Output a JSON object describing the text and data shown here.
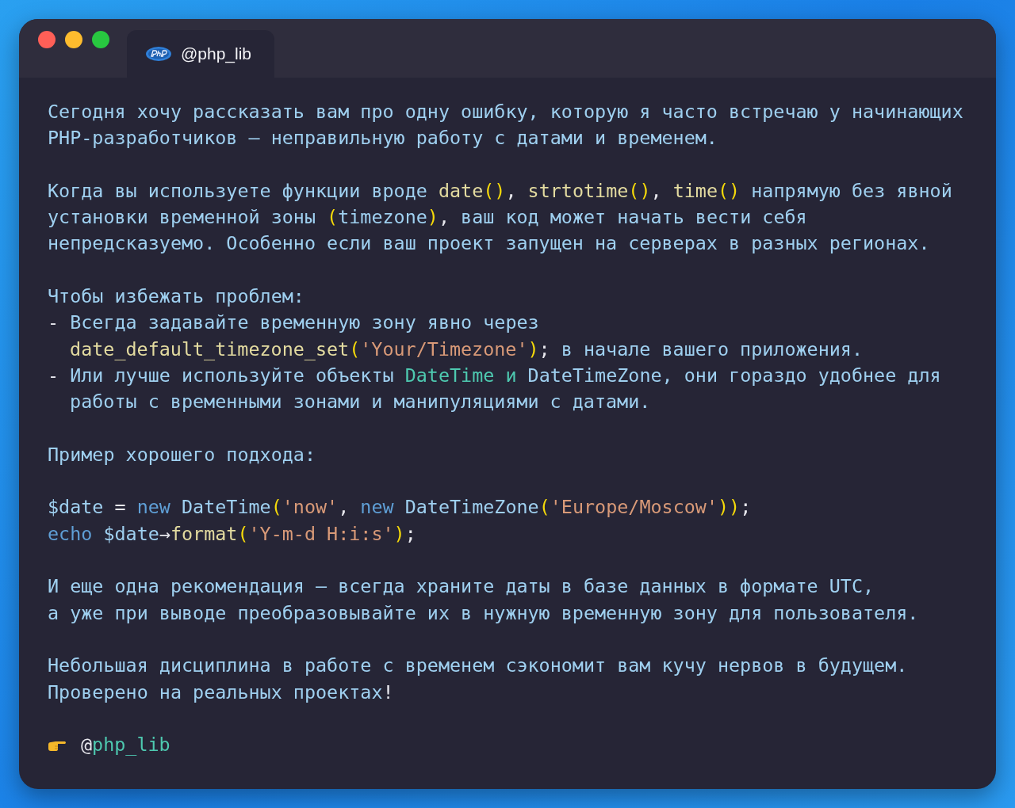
{
  "window": {
    "traffic_lights": [
      {
        "color": "#ff5f57"
      },
      {
        "color": "#febc2e"
      },
      {
        "color": "#28c840"
      }
    ],
    "tab": {
      "label": "@php_lib",
      "selected": true
    }
  },
  "paragraphs": [
    {
      "lines": [
        {
          "kind": "text",
          "tokens": [
            {
              "kind": "text",
              "text": "Сегодня хочу рассказать вам про одну ошибку, которую я часто встречаю у начинающих"
            }
          ]
        },
        {
          "kind": "text",
          "tokens": [
            {
              "kind": "text",
              "text": "PHP-разработчиков — неправильную работу с датами и временем."
            }
          ]
        }
      ]
    },
    {
      "lines": [
        {
          "kind": "text",
          "tokens": [
            {
              "kind": "text",
              "text": "Когда вы используете функции вроде "
            },
            {
              "kind": "fn",
              "text": "date"
            },
            {
              "kind": "paren",
              "text": "()"
            },
            {
              "kind": "plain",
              "text": ", "
            },
            {
              "kind": "fn",
              "text": "strtotime"
            },
            {
              "kind": "paren",
              "text": "()"
            },
            {
              "kind": "plain",
              "text": ", "
            },
            {
              "kind": "fn",
              "text": "time"
            },
            {
              "kind": "paren",
              "text": "()"
            },
            {
              "kind": "text",
              "text": " напрямую без явной"
            }
          ]
        },
        {
          "kind": "text",
          "tokens": [
            {
              "kind": "text",
              "text": "установки временной зоны "
            },
            {
              "kind": "paren",
              "text": "("
            },
            {
              "kind": "text",
              "text": "timezone"
            },
            {
              "kind": "paren",
              "text": ")"
            },
            {
              "kind": "plain",
              "text": ", "
            },
            {
              "kind": "text",
              "text": "ваш код может начать вести себя"
            }
          ]
        },
        {
          "kind": "text",
          "tokens": [
            {
              "kind": "text",
              "text": "непредсказуемо. Особенно если ваш проект запущен на серверах в разных регионах."
            }
          ]
        }
      ]
    },
    {
      "lines": [
        {
          "kind": "text",
          "tokens": [
            {
              "kind": "text",
              "text": "Чтобы избежать проблем:"
            }
          ]
        },
        {
          "kind": "text",
          "tokens": [
            {
              "kind": "plain",
              "text": "- "
            },
            {
              "kind": "text",
              "text": "Всегда задавайте временную зону явно через"
            }
          ]
        },
        {
          "kind": "continuation",
          "tokens": [
            {
              "kind": "fn",
              "text": "date_default_timezone_set"
            },
            {
              "kind": "paren",
              "text": "("
            },
            {
              "kind": "string",
              "text": "'Your/Timezone'"
            },
            {
              "kind": "paren",
              "text": ")"
            },
            {
              "kind": "plain",
              "text": "; "
            },
            {
              "kind": "text",
              "text": "в начале вашего приложения."
            }
          ]
        },
        {
          "kind": "text",
          "tokens": [
            {
              "kind": "plain",
              "text": "- "
            },
            {
              "kind": "text",
              "text": "Или лучше используйте объекты "
            },
            {
              "kind": "class",
              "text": "DateTime и"
            },
            {
              "kind": "text",
              "text": " DateTimeZone, они гораздо удобнее для"
            }
          ]
        },
        {
          "kind": "continuation",
          "tokens": [
            {
              "kind": "text",
              "text": "работы с временными зонами и манипуляциями с датами."
            }
          ]
        }
      ]
    },
    {
      "lines": [
        {
          "kind": "text",
          "tokens": [
            {
              "kind": "text",
              "text": "Пример хорошего подхода:"
            }
          ]
        }
      ]
    },
    {
      "lines": [
        {
          "kind": "code",
          "tokens": [
            {
              "kind": "text",
              "text": "$date"
            },
            {
              "kind": "plain",
              "text": " = "
            },
            {
              "kind": "keyword",
              "text": "new"
            },
            {
              "kind": "text",
              "text": " DateTime"
            },
            {
              "kind": "paren",
              "text": "("
            },
            {
              "kind": "string",
              "text": "'now'"
            },
            {
              "kind": "plain",
              "text": ", "
            },
            {
              "kind": "keyword",
              "text": "new"
            },
            {
              "kind": "text",
              "text": " DateTimeZone"
            },
            {
              "kind": "paren",
              "text": "("
            },
            {
              "kind": "string",
              "text": "'Europe/Moscow'"
            },
            {
              "kind": "paren",
              "text": "))"
            },
            {
              "kind": "plain",
              "text": ";"
            }
          ]
        },
        {
          "kind": "code",
          "tokens": [
            {
              "kind": "keyword",
              "text": "echo"
            },
            {
              "kind": "text",
              "text": " $date"
            },
            {
              "kind": "plain",
              "text": "→"
            },
            {
              "kind": "fn",
              "text": "format"
            },
            {
              "kind": "paren",
              "text": "("
            },
            {
              "kind": "string",
              "text": "'Y-m-d H:i:s'"
            },
            {
              "kind": "paren",
              "text": ")"
            },
            {
              "kind": "plain",
              "text": ";"
            }
          ]
        }
      ]
    },
    {
      "lines": [
        {
          "kind": "text",
          "tokens": [
            {
              "kind": "text",
              "text": "И еще одна рекомендация — всегда храните даты в базе данных в формате UTC,"
            }
          ]
        },
        {
          "kind": "text",
          "tokens": [
            {
              "kind": "text",
              "text": "а уже при выводе преобразовывайте их в нужную временную зону для пользователя."
            }
          ]
        }
      ]
    },
    {
      "lines": [
        {
          "kind": "text",
          "tokens": [
            {
              "kind": "text",
              "text": "Небольшая дисциплина в работе с временем сэкономит вам кучу нервов в будущем."
            }
          ]
        },
        {
          "kind": "text",
          "tokens": [
            {
              "kind": "text",
              "text": "Проверено на реальных проектах"
            },
            {
              "kind": "plain",
              "text": "!"
            }
          ]
        }
      ]
    }
  ],
  "signature": {
    "prefix": "@",
    "handle": "php_lib"
  }
}
